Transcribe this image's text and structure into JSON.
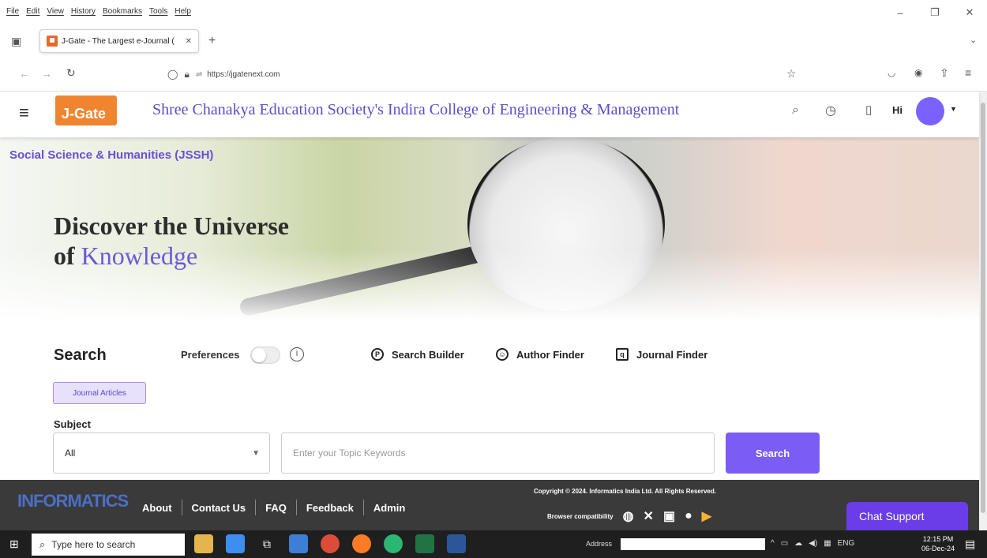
{
  "browser": {
    "menu": [
      "File",
      "Edit",
      "View",
      "History",
      "Bookmarks",
      "Tools",
      "Help"
    ],
    "tab_title": "J-Gate - The Largest e-Journal (",
    "url": "https://jgatenext.com"
  },
  "header": {
    "logo": "J-Gate",
    "college": "Shree Chanakya Education Society's Indira College of Engineering & Management",
    "greeting": "Hi"
  },
  "hero": {
    "category": "Social Science & Humanities (JSSH)",
    "title_line1": "Discover the Universe",
    "title_line2_prefix": "of ",
    "title_line2_accent": "Knowledge"
  },
  "search": {
    "heading": "Search",
    "preferences_label": "Preferences",
    "tools": [
      "Search Builder",
      "Author Finder",
      "Journal Finder"
    ],
    "chip": "Journal Articles",
    "subject_label": "Subject",
    "subject_value": "All",
    "keyword_placeholder": "Enter your Topic Keywords",
    "button": "Search"
  },
  "footer": {
    "brand": "INFORMATICS",
    "links": [
      "About",
      "Contact Us",
      "FAQ",
      "Feedback",
      "Admin"
    ],
    "copyright": "Copyright © 2024. Informatics India Ltd. All Rights Reserved.",
    "compat_label": "Browser compatibility",
    "chat": "Chat Support"
  },
  "taskbar": {
    "search_placeholder": "Type here to search",
    "address_label": "Address",
    "lang": "ENG",
    "time": "12:15 PM",
    "date": "06-Dec-24"
  },
  "colors": {
    "accent": "#7b5cf5",
    "brand_orange": "#f0852f",
    "college_text": "#5b4ec9",
    "footer_bg": "#3a3a3a"
  }
}
